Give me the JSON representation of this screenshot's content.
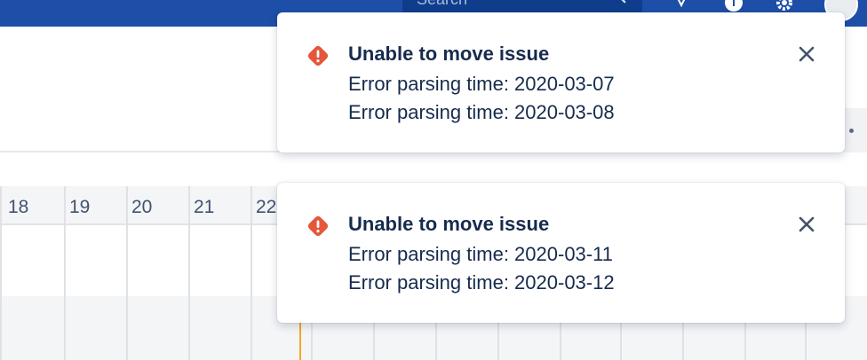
{
  "nav": {
    "search_placeholder": "Search",
    "icons": [
      "search-icon",
      "notifications-icon",
      "help-icon",
      "settings-icon",
      "avatar"
    ]
  },
  "timeline": {
    "days": [
      "18",
      "19",
      "20",
      "21",
      "22"
    ]
  },
  "toasts": [
    {
      "title": "Unable to move issue",
      "lines": [
        "Error parsing time: 2020-03-07",
        "Error parsing time: 2020-03-08"
      ],
      "icon": "warning-icon",
      "color": "#e5563a"
    },
    {
      "title": "Unable to move issue",
      "lines": [
        "Error parsing time: 2020-03-11",
        "Error parsing time: 2020-03-12"
      ],
      "icon": "warning-icon",
      "color": "#e5563a"
    }
  ],
  "colors": {
    "nav_bg": "#1d4fa8",
    "warning": "#e5563a",
    "today_line": "#f5a623"
  }
}
